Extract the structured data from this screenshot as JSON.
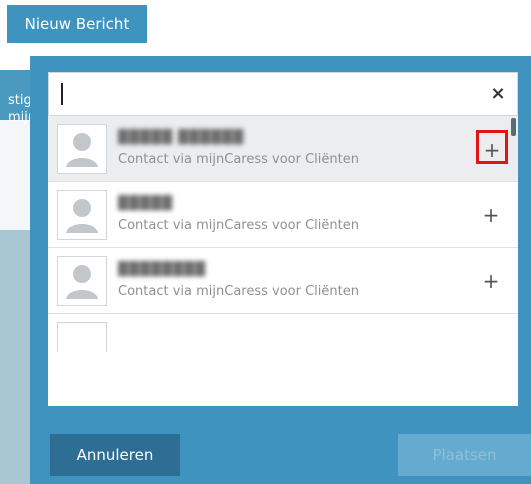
{
  "header": {
    "tab_label": "Nieuw Bericht"
  },
  "background_text": {
    "line1": "stig",
    "line2": "mijr"
  },
  "search": {
    "value": "",
    "clear_label": "×"
  },
  "results": [
    {
      "name": "█████ ██████",
      "subtitle": "Contact via mijnCaress voor Cliënten",
      "add_label": "+"
    },
    {
      "name": "█████",
      "subtitle": "Contact via mijnCaress voor Cliënten",
      "add_label": "+"
    },
    {
      "name": "████████",
      "subtitle": "Contact via mijnCaress voor Cliënten",
      "add_label": "+"
    }
  ],
  "footer": {
    "cancel_label": "Annuleren",
    "submit_label": "Plaatsen"
  },
  "colors": {
    "accent": "#3f94bf",
    "cancel": "#2f6e94",
    "highlight_box": "#e01515"
  }
}
